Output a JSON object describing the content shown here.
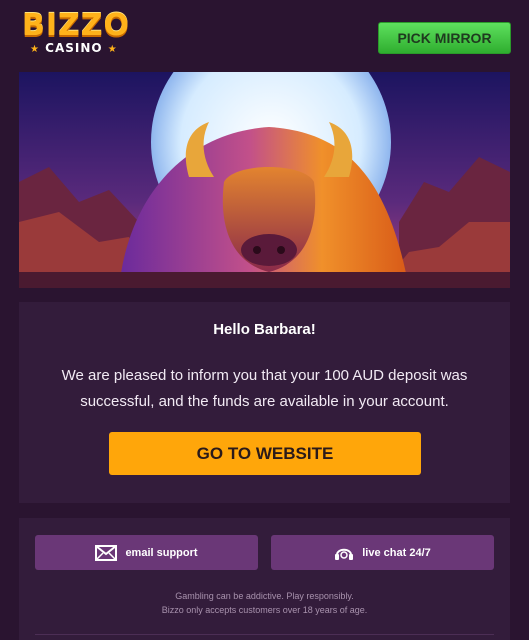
{
  "header": {
    "logo_main": "BIZZO",
    "logo_sub": "CASINO",
    "pick_mirror_label": "PICK MIRROR"
  },
  "hero": {
    "description_icon": "buffalo-moon-banner"
  },
  "message": {
    "greeting": "Hello Barbara!",
    "body": "We are pleased to inform you that your 100 AUD deposit was successful, and the funds are available in your account.",
    "cta_label": "GO TO WEBSITE"
  },
  "footer": {
    "email_support_label": "email support",
    "live_chat_label": "live chat 24/7",
    "disclaimer_line1": "Gambling can be addictive. Play responsibly.",
    "disclaimer_line2": "Bizzo only accepts customers over 18 years of age."
  },
  "colors": {
    "background": "#2a1430",
    "card": "#331c3b",
    "accent_orange": "#ffa60a",
    "mirror_green": "#3fc23f",
    "support_purple": "#6a3777"
  },
  "icons": {
    "email": "envelope-icon",
    "chat": "headset-icon"
  }
}
